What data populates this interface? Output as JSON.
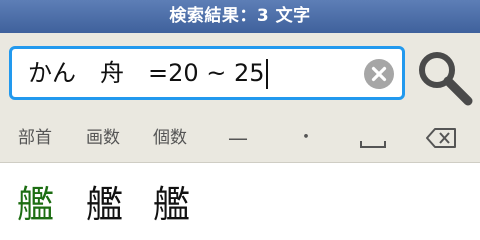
{
  "title_bar": {
    "label": "検索結果：3 文字"
  },
  "search": {
    "value": "かん　舟　=20 ~ 25",
    "clear_icon": "clear-circle-x-icon",
    "search_icon": "magnifier-icon"
  },
  "toolbar": {
    "radical_label": "部首",
    "strokes_label": "画数",
    "count_label": "個数",
    "dash_label": "—",
    "dot_label": "・",
    "space_icon": "space-bar-icon",
    "backspace_icon": "backspace-icon"
  },
  "results": {
    "items": [
      {
        "char": "艦",
        "color": "#1c6d12"
      },
      {
        "char": "艦",
        "color": "#111111"
      },
      {
        "char": "艦",
        "color": "#111111"
      }
    ]
  },
  "colors": {
    "accent": "#2299ee",
    "title_bar": "#4a6aa5",
    "toolbar_bg": "#eae8e0",
    "highlight_kanji": "#1c6d12"
  }
}
